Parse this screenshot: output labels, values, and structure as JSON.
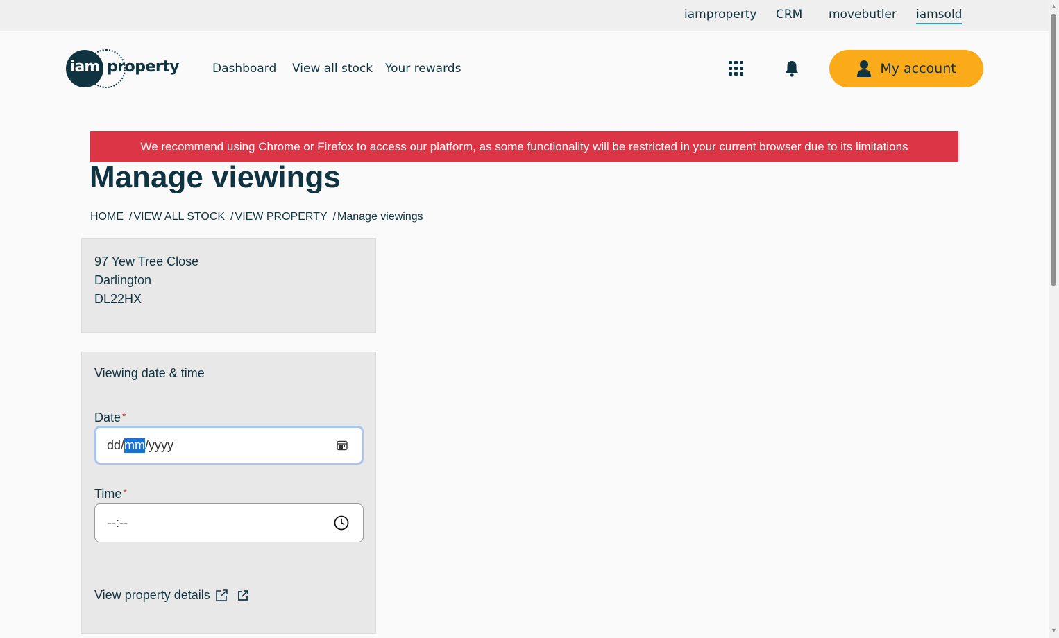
{
  "topnav": {
    "items": [
      "iamproperty",
      "CRM",
      "movebutler",
      "iamsold"
    ],
    "active": "iamsold"
  },
  "logo": {
    "iam": "iam",
    "property": "property"
  },
  "nav": {
    "items": [
      "Dashboard",
      "View all stock",
      "Your rewards"
    ]
  },
  "header": {
    "account_label": "My account",
    "account_color": "#fbaa1a",
    "apps_icon": "grid-icon",
    "bell_icon": "bell-icon"
  },
  "banner": {
    "text": "We recommend using Chrome or Firefox to access our platform, as some functionality will be restricted in your current browser due to its limitations",
    "color": "#dc3545"
  },
  "page": {
    "title": "Manage viewings"
  },
  "breadcrumb": [
    "HOME",
    "VIEW ALL STOCK",
    "VIEW PROPERTY",
    "Manage viewings"
  ],
  "address": {
    "line1": "97 Yew Tree Close",
    "line2": "Darlington",
    "line3": "DL22HX"
  },
  "viewing": {
    "title": "Viewing date & time",
    "date_label": "Date",
    "date_value": {
      "pre": "dd/",
      "selected": "mm",
      "post": "/yyyy"
    },
    "time_label": "Time",
    "time_value": "--:--",
    "required_mark": "*",
    "details_link": "View property details"
  }
}
